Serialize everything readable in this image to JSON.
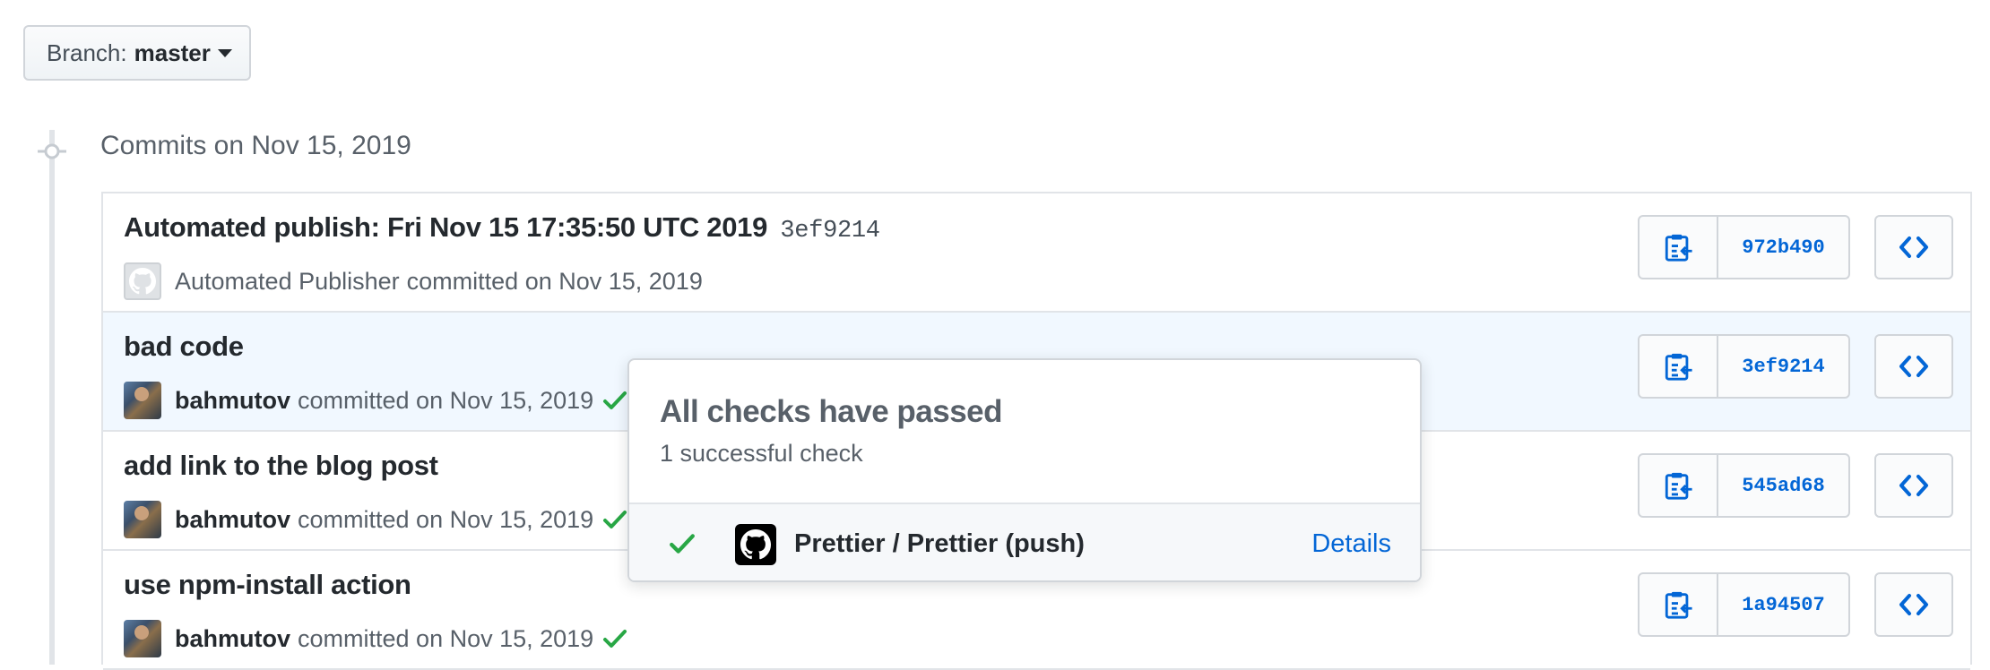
{
  "branch": {
    "label": "Branch:",
    "name": "master"
  },
  "group": {
    "title": "Commits on Nov 15, 2019"
  },
  "commits": [
    {
      "message": "Automated publish: Fri Nov 15 17:35:50 UTC 2019",
      "inline_sha": "3ef9214",
      "author": "",
      "avatar_text": "Automated Publisher",
      "meta": "committed on Nov 15, 2019",
      "sha": "972b490",
      "status": "none"
    },
    {
      "message": "bad code",
      "inline_sha": "",
      "author": "bahmutov",
      "meta": "committed on Nov 15, 2019",
      "sha": "3ef9214",
      "status": "success"
    },
    {
      "message": "add link to the blog post",
      "inline_sha": "",
      "author": "bahmutov",
      "meta": "committed on Nov 15, 2019",
      "sha": "545ad68",
      "status": "success"
    },
    {
      "message": "use npm-install action",
      "inline_sha": "",
      "author": "bahmutov",
      "meta": "committed on Nov 15, 2019",
      "sha": "1a94507",
      "status": "success"
    }
  ],
  "popover": {
    "title": "All checks have passed",
    "subtitle": "1 successful check",
    "check": {
      "name": "Prettier / Prettier (push)",
      "link": "Details",
      "status": "success"
    }
  },
  "icons": {
    "copy": "clipboard-copy-icon",
    "browse": "code-brackets-icon",
    "status": "check-icon",
    "node": "commit-node-icon",
    "app": "github-mark-icon"
  },
  "colors": {
    "link": "#0366d6",
    "success": "#28a745",
    "highlight": "#f1f8ff"
  }
}
